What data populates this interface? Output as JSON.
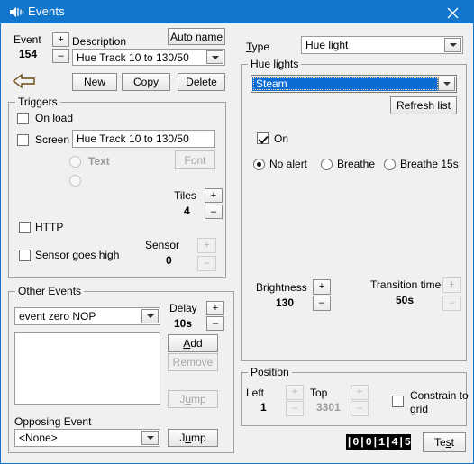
{
  "window": {
    "title": "Events",
    "icon": "audio-speaker-icon",
    "close_label": "✕",
    "border_color": "#1176cc",
    "titlebar_color": "#1176cc"
  },
  "left": {
    "event_label": "Event",
    "event_number": "154",
    "event_plus": "+",
    "event_minus": "–",
    "back_arrow_icon": "back-arrow-icon",
    "description_label": "Description",
    "auto_name_label": "Auto name",
    "description_value": "Hue Track 10 to 130/50",
    "new_label": "New",
    "copy_label": "Copy",
    "delete_label": "Delete",
    "triggers": {
      "title": "Triggers",
      "on_load_label": "On load",
      "on_load_checked": false,
      "screen_label": "Screen",
      "screen_checked": false,
      "screen_value": "Hue Track 10 to 130/50",
      "text_radio_label": "Text",
      "text_radio_checked": false,
      "font_label": "Font",
      "tiles_label": "Tiles",
      "tiles_value": "4",
      "tiles_plus": "+",
      "tiles_minus": "–",
      "http_label": "HTTP",
      "http_checked": false,
      "sensor_high_label": "Sensor goes high",
      "sensor_high_checked": false,
      "sensor_label": "Sensor",
      "sensor_value": "0",
      "sensor_plus": "+",
      "sensor_minus": "–"
    },
    "other_events": {
      "title": "Other Events",
      "event_select_value": "event zero NOP",
      "delay_label": "Delay",
      "delay_value": "10s",
      "delay_plus": "+",
      "delay_minus": "–",
      "add_label": "Add",
      "remove_label": "Remove",
      "jump_label": "Jump",
      "opposing_label": "Opposing Event",
      "opposing_value": "<None>",
      "opposing_jump_label": "Jump"
    }
  },
  "right": {
    "type_label": "Type",
    "type_value": "Hue light",
    "hue_lights": {
      "title": "Hue lights",
      "selected_light": "Steam",
      "refresh_label": "Refresh list",
      "on_label": "On",
      "on_checked": true,
      "alerts": [
        {
          "label": "No alert",
          "checked": true
        },
        {
          "label": "Breathe",
          "checked": false
        },
        {
          "label": "Breathe 15s",
          "checked": false
        }
      ],
      "brightness_label": "Brightness",
      "brightness_value": "130",
      "brightness_plus": "+",
      "brightness_minus": "–",
      "transition_label": "Transition time",
      "transition_value": "50s",
      "transition_plus": "+",
      "transition_minus": "–"
    },
    "position": {
      "title": "Position",
      "left_label": "Left",
      "left_value": "1",
      "left_plus": "+",
      "left_minus": "–",
      "top_label": "Top",
      "top_value": "3301",
      "top_plus": "+",
      "top_minus": "–",
      "constrain_label_line1": "Constrain to",
      "constrain_label_line2": "grid",
      "constrain_checked": false
    },
    "counter_display": "|0|0|1|4|5",
    "test_label": "Test"
  }
}
